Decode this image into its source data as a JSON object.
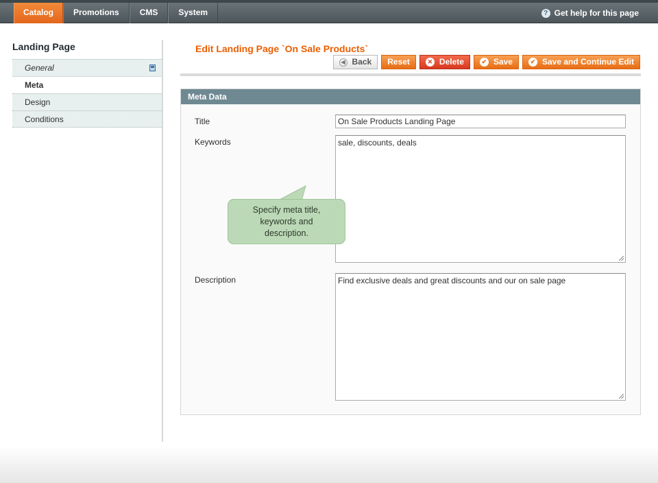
{
  "nav": {
    "items": [
      {
        "label": "Catalog",
        "active": true
      },
      {
        "label": "Promotions",
        "active": false
      },
      {
        "label": "CMS",
        "active": false
      },
      {
        "label": "System",
        "active": false
      }
    ],
    "help_label": "Get help for this page",
    "help_icon": "question-icon"
  },
  "sidebar": {
    "title": "Landing Page",
    "items": [
      {
        "label": "General",
        "icon": "save-icon"
      },
      {
        "label": "Meta"
      },
      {
        "label": "Design"
      },
      {
        "label": "Conditions"
      }
    ]
  },
  "main": {
    "title": "Edit Landing Page `On Sale Products`",
    "buttons": {
      "back": "Back",
      "reset": "Reset",
      "delete": "Delete",
      "save": "Save",
      "save_continue": "Save and Continue Edit"
    },
    "fieldset": {
      "legend": "Meta Data",
      "fields": {
        "title_label": "Title",
        "title_value": "On Sale Products Landing Page",
        "keywords_label": "Keywords",
        "keywords_value": "sale, discounts, deals",
        "description_label": "Description",
        "description_value": "Find exclusive deals and great discounts and our on sale page"
      }
    },
    "callout": {
      "line1": "Specify meta title,",
      "line2": "keywords and",
      "line3": "description."
    }
  },
  "colors": {
    "accent": "#eb5e00",
    "button_orange": "#e86d14",
    "button_red": "#d8391f",
    "fieldset_header": "#6f8992",
    "callout": "#bcd9b7"
  }
}
